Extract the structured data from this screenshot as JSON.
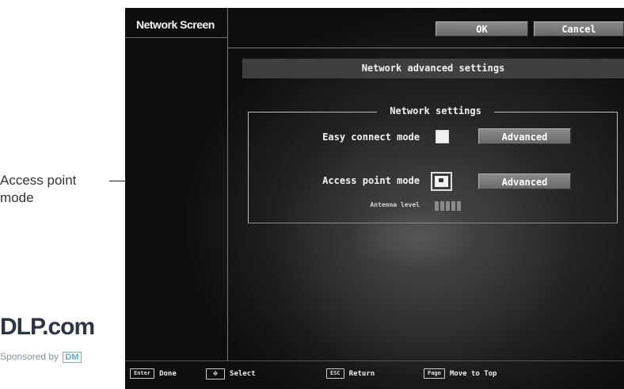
{
  "annotation": {
    "callout_text": "Access point mode",
    "watermark": "DLP.com",
    "watermark_sub": "Sponsored by",
    "watermark_sub_logo": "DM"
  },
  "screen": {
    "title": "Network Screen",
    "ok_label": "OK",
    "cancel_label": "Cancel",
    "section_title": "Network advanced settings",
    "group_title": "Network settings",
    "easy_connect": {
      "label": "Easy connect mode",
      "checked": false,
      "advanced_label": "Advanced"
    },
    "access_point": {
      "label": "Access point mode",
      "checked": true,
      "advanced_label": "Advanced"
    },
    "antenna": {
      "label": "Antenna level",
      "bars_total": 5,
      "bars_on": 0
    },
    "help_bar": {
      "done": {
        "key": "Enter",
        "label": "Done"
      },
      "select": {
        "key": "arrows",
        "label": "Select"
      },
      "return": {
        "key": "ESC",
        "label": "Return"
      },
      "move_top": {
        "key": "Page",
        "label": "Move to Top"
      }
    }
  }
}
